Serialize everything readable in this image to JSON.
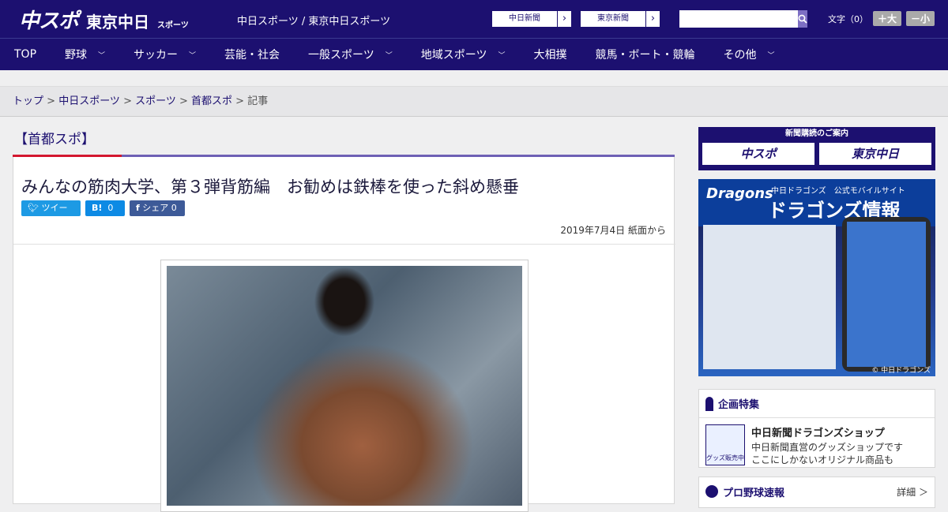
{
  "header": {
    "logo_main": "中スポ",
    "logo_sub": "東京中日",
    "logo_sub_small": "スポーツ",
    "site_name": "中日スポーツ / 東京中日スポーツ",
    "links": [
      {
        "label": "中日新聞"
      },
      {
        "label": "東京新聞"
      }
    ],
    "search_placeholder": "",
    "font_size_label": "文字（0）",
    "font_up": "＋大",
    "font_down": "－小"
  },
  "nav": [
    {
      "label": "TOP",
      "has_menu": false
    },
    {
      "label": "野球",
      "has_menu": true
    },
    {
      "label": "サッカー",
      "has_menu": true
    },
    {
      "label": "芸能・社会",
      "has_menu": false
    },
    {
      "label": "一般スポーツ",
      "has_menu": true
    },
    {
      "label": "地域スポーツ",
      "has_menu": true
    },
    {
      "label": "大相撲",
      "has_menu": false
    },
    {
      "label": "競馬・ボート・競輪",
      "has_menu": false
    },
    {
      "label": "その他",
      "has_menu": true
    }
  ],
  "breadcrumb": [
    {
      "label": "トップ"
    },
    {
      "label": "中日スポーツ"
    },
    {
      "label": "スポーツ"
    },
    {
      "label": "首都スポ"
    },
    {
      "label": "記事"
    }
  ],
  "section_title": "【首都スポ】",
  "article": {
    "title": "みんなの筋肉大学、第３弾背筋編　お勧めは鉄棒を使った斜め懸垂",
    "tweet_label": "ツイート",
    "hatena_label": "B!",
    "hatena_count": "0",
    "share_label": "シェア",
    "share_count": "0",
    "date": "2019年7月4日 紙面から"
  },
  "sidebar": {
    "subscribe_header": "新聞購読のご案内",
    "subscribe_buttons": [
      "中スポ",
      "東京中日"
    ],
    "ad_brand": "Dragons",
    "ad_sub": "中日ドラゴンズ　公式モバイルサイト",
    "ad_title": "ドラゴンズ情報",
    "ad_copyright": "© 中日ドラゴンズ",
    "special_title": "企画特集",
    "shop_img_label": "グッズ販売中",
    "shop_title": "中日新聞ドラゴンズショップ",
    "shop_desc1": "中日新聞直営のグッズショップです",
    "shop_desc2": "ここにしかないオリジナル商品も",
    "baseball_title": "プロ野球速報",
    "baseball_more": "詳細 ＞"
  },
  "colors": {
    "brand": "#1c1070",
    "accent": "#d3172f",
    "twitter": "#1d9ae4",
    "facebook": "#3d5a98"
  }
}
